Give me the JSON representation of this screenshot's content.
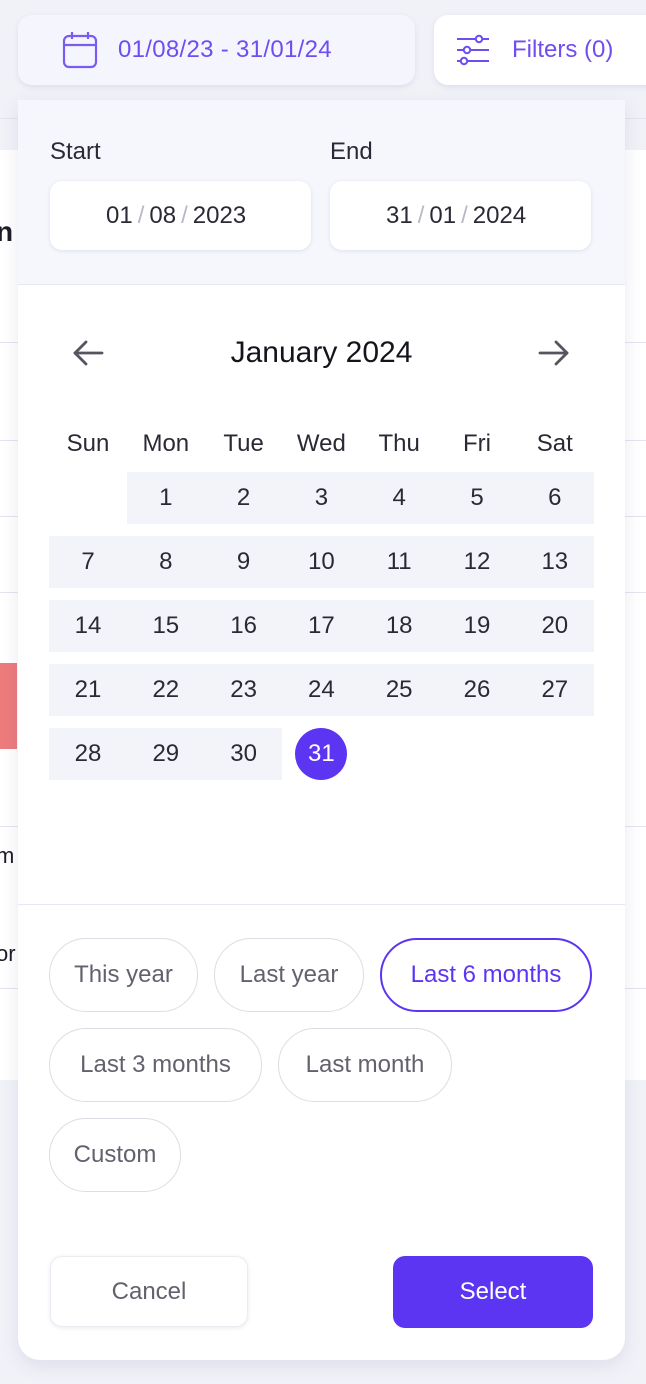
{
  "colors": {
    "accent": "#5b35f2",
    "accent_text": "#6f4df0",
    "range_fill": "#f3f4fa"
  },
  "top_bar": {
    "date_range_label": "01/08/23 - 31/01/24",
    "calendar_icon": "calendar-icon",
    "filters_label": "Filters (0)",
    "filters_icon": "sliders-icon"
  },
  "range": {
    "start_label": "Start",
    "end_label": "End",
    "start": {
      "day": "01",
      "month": "08",
      "year": "2023"
    },
    "end": {
      "day": "31",
      "month": "01",
      "year": "2024"
    }
  },
  "calendar": {
    "month_title": "January 2024",
    "prev_icon": "arrow-left-icon",
    "next_icon": "arrow-right-icon",
    "weekdays": [
      "Sun",
      "Mon",
      "Tue",
      "Wed",
      "Thu",
      "Fri",
      "Sat"
    ],
    "first_weekday_index": 1,
    "days_in_month": 31,
    "selected_day": 31,
    "in_range_through": 30
  },
  "presets": {
    "items": [
      "This year",
      "Last year",
      "Last 6 months",
      "Last 3 months",
      "Last month",
      "Custom"
    ],
    "active": "Last 6 months"
  },
  "actions": {
    "cancel_label": "Cancel",
    "select_label": "Select"
  },
  "background": {
    "fragments": [
      "n",
      "m",
      "or"
    ]
  }
}
